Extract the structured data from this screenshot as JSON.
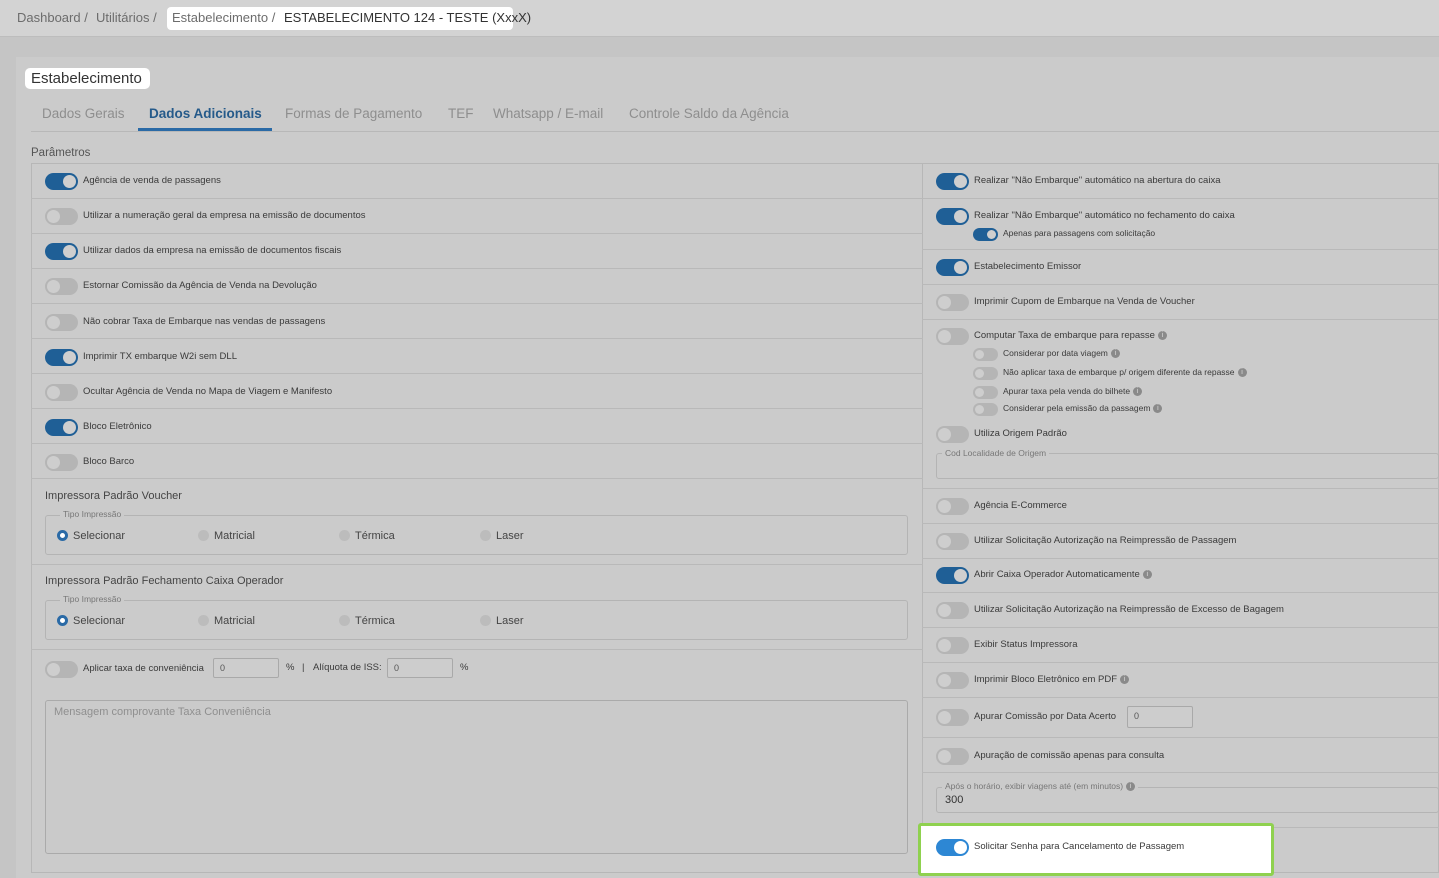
{
  "breadcrumb": {
    "items": [
      "Dashboard /",
      "Utilitários /",
      "Estabelecimento /",
      "ESTABELECIMENTO 124 - TESTE (XxxX)"
    ]
  },
  "card": {
    "title": "Estabelecimento"
  },
  "tabs": [
    "Dados Gerais",
    "Dados Adicionais",
    "Formas de Pagamento",
    "TEF",
    "Whatsapp / E-mail",
    "Controle Saldo da Agência"
  ],
  "section_title": "Parâmetros",
  "left_toggles": [
    {
      "label": "Agência de venda de passagens",
      "on": true
    },
    {
      "label": "Utilizar a numeração geral da empresa na emissão de documentos",
      "on": false
    },
    {
      "label": "Utilizar dados da empresa na emissão de documentos fiscais",
      "on": true
    },
    {
      "label": "Estornar Comissão da Agência de Venda na Devolução",
      "on": false
    },
    {
      "label": "Não cobrar Taxa de Embarque nas vendas de passagens",
      "on": false
    },
    {
      "label": "Imprimir TX embarque W2i sem DLL",
      "on": true
    },
    {
      "label": "Ocultar Agência de Venda no Mapa de Viagem e Manifesto",
      "on": false
    },
    {
      "label": "Bloco Eletrônico",
      "on": true
    },
    {
      "label": "Bloco Barco",
      "on": false
    }
  ],
  "printer_voucher": {
    "title": "Impressora Padrão Voucher",
    "legend": "Tipo Impressão",
    "options": [
      "Selecionar",
      "Matricial",
      "Térmica",
      "Laser"
    ],
    "selected": "Selecionar"
  },
  "printer_caixa": {
    "title": "Impressora Padrão Fechamento Caixa Operador",
    "legend": "Tipo Impressão",
    "options": [
      "Selecionar",
      "Matricial",
      "Térmica",
      "Laser"
    ],
    "selected": "Selecionar"
  },
  "conveniencia": {
    "label": "Aplicar taxa de conveniência",
    "value": "0",
    "percent": "%",
    "separator": "|",
    "iss_label": "Alíquota de ISS:",
    "iss_value": "0",
    "iss_percent": "%",
    "message_placeholder": "Mensagem comprovante Taxa Conveniência"
  },
  "right": {
    "nao_embarque_abertura": "Realizar \"Não Embarque\" automático na abertura do caixa",
    "nao_embarque_fechamento": "Realizar \"Não Embarque\" automático no fechamento do caixa",
    "apenas_solicitacao": "Apenas para passagens com solicitação",
    "estab_emissor": "Estabelecimento Emissor",
    "imprimir_cupom": "Imprimir Cupom de Embarque na Venda de Voucher",
    "computar_taxa": "Computar Taxa de embarque para repasse",
    "considerar_data": "Considerar por data viagem",
    "nao_aplicar": "Não aplicar taxa de embarque p/ origem diferente da repasse",
    "apurar_taxa": "Apurar taxa pela venda do bilhete",
    "considerar_emissao": "Considerar pela emissão da passagem",
    "origem_padrao": "Utiliza Origem Padrão",
    "cod_localidade": "Cod Localidade de Origem",
    "agencia_ecommerce": "Agência E-Commerce",
    "solic_reimpressao": "Utilizar Solicitação Autorização na Reimpressão de Passagem",
    "abrir_caixa": "Abrir Caixa Operador Automaticamente",
    "solic_excesso": "Utilizar Solicitação Autorização na Reimpressão de Excesso de Bagagem",
    "exibir_status": "Exibir Status Impressora",
    "imprimir_bloco_pdf": "Imprimir Bloco Eletrônico em PDF",
    "apurar_comissao": "Apurar Comissão por Data Acerto",
    "apurar_comissao_value": "0",
    "apuracao_consulta": "Apuração de comissão apenas para consulta",
    "apos_horario": "Após o horário, exibir viagens até (em minutos)",
    "apos_horario_value": "300",
    "solicitar_senha": "Solicitar Senha para Cancelamento de Passagem"
  },
  "icons": {
    "info": "info-icon"
  }
}
